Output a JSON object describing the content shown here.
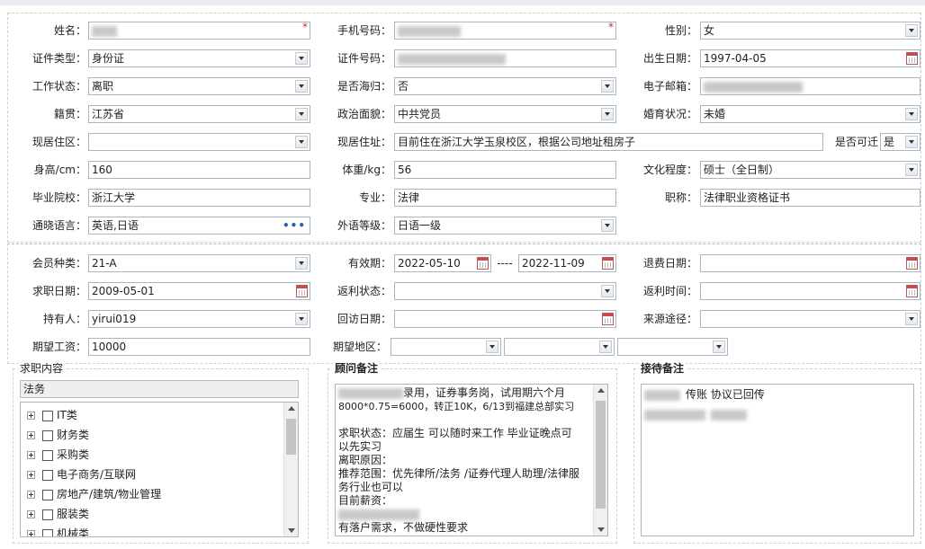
{
  "row1": {
    "name_label": "姓名：",
    "phone_label": "手机号码：",
    "gender_label": "性别：",
    "gender_value": "女",
    "required": "*"
  },
  "row2": {
    "id_type_label": "证件类型：",
    "id_type_value": "身份证",
    "id_no_label": "证件号码：",
    "birth_label": "出生日期：",
    "birth_value": "1997-04-05"
  },
  "row3": {
    "work_label": "工作状态：",
    "work_value": "离职",
    "overseas_label": "是否海归：",
    "overseas_value": "否",
    "email_label": "电子邮箱："
  },
  "row4": {
    "origin_label": "籍贯：",
    "origin_value": "江苏省",
    "politics_label": "政治面貌：",
    "politics_value": "中共党员",
    "marital_label": "婚育状况：",
    "marital_value": "未婚"
  },
  "row5": {
    "res_label": "现居住区：",
    "res_value": "",
    "addr_label": "现居住址：",
    "addr_value": "目前住在浙江大学玉泉校区，根据公司地址租房子",
    "relocate_label": "是否可迁",
    "relocate_value": "是"
  },
  "row6": {
    "height_label": "身高/cm：",
    "height_value": "160",
    "weight_label": "体重/kg：",
    "weight_value": "56",
    "edu_label": "文化程度：",
    "edu_value": "硕士（全日制）"
  },
  "row7": {
    "school_label": "毕业院校：",
    "school_value": "浙江大学",
    "major_label": "专业：",
    "major_value": "法律",
    "title_label": "职称：",
    "title_value": "法律职业资格证书"
  },
  "row8": {
    "lang_label": "通晓语言：",
    "lang_value": "英语,日语",
    "lang_more": "•••",
    "foreign_label": "外语等级：",
    "foreign_value": "日语一级"
  },
  "row9": {
    "member_label": "会员种类：",
    "member_value": "21-A",
    "valid_label": "有效期：",
    "valid_from": "2022-05-10",
    "valid_sep": "----",
    "valid_to": "2022-11-09",
    "refund_date_label": "退费日期："
  },
  "row10": {
    "job_date_label": "求职日期：",
    "job_date_value": "2009-05-01",
    "rebate_status_label": "返利状态：",
    "rebate_time_label": "返利时间："
  },
  "row11": {
    "holder_label": "持有人：",
    "holder_value": "yirui019",
    "revisit_label": "回访日期：",
    "source_label": "来源途径："
  },
  "row12": {
    "salary_label": "期望工资：",
    "salary_value": "10000",
    "region_label": "期望地区："
  },
  "job_content": {
    "title": "求职内容",
    "selected": "法务",
    "items": [
      "IT类",
      "财务类",
      "采购类",
      "电子商务/互联网",
      "房地产/建筑/物业管理",
      "服装类",
      "机械类"
    ]
  },
  "advisor_notes": {
    "title": "顾问备注",
    "lines": [
      "录用，证券事务岗，试用期六个月",
      "8000*0.75=6000，转正10K，6/13到福建总部实习",
      "",
      "求职状态：应届生 可以随时来工作  毕业证晚点可",
      "以先实习",
      "离职原因：",
      "推荐范围：优先律所/法务 /证券代理人助理/法律服",
      "务行业也可以",
      "目前薪资：",
      "",
      "有落户需求，不做硬性要求"
    ]
  },
  "reception_notes": {
    "title": "接待备注",
    "line1": "传账 协议已回传"
  },
  "colors": {
    "border": "#a9b6c4",
    "required": "#dd2222",
    "accent": "#2a5fae"
  }
}
